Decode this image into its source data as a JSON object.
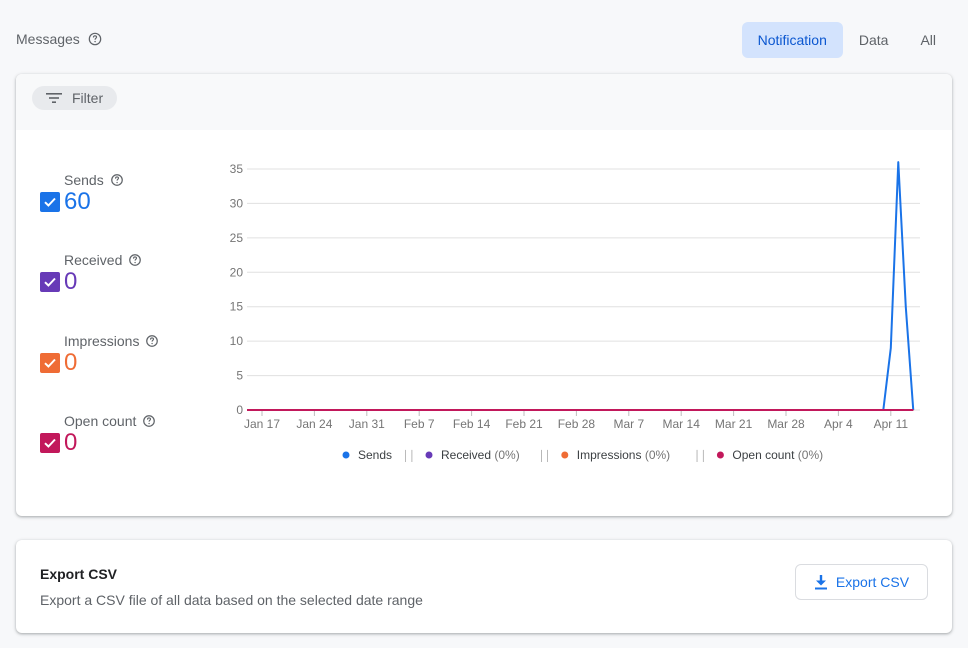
{
  "header": {
    "title": "Messages",
    "segments": [
      "Notification",
      "Data",
      "All"
    ],
    "active_segment": "Notification"
  },
  "filter": {
    "label": "Filter"
  },
  "metrics": [
    {
      "label": "Sends",
      "value": "60",
      "color": "#1a73e8"
    },
    {
      "label": "Received",
      "value": "0",
      "color": "#673ab7"
    },
    {
      "label": "Impressions",
      "value": "0",
      "color": "#ef6c35"
    },
    {
      "label": "Open count",
      "value": "0",
      "color": "#c2185b"
    }
  ],
  "chart_data": {
    "type": "line",
    "x_tick_labels": [
      "Jan 17",
      "Jan 24",
      "Jan 31",
      "Feb 7",
      "Feb 14",
      "Feb 21",
      "Feb 28",
      "Mar 7",
      "Mar 14",
      "Mar 21",
      "Mar 28",
      "Apr 4",
      "Apr 11"
    ],
    "y_ticks": [
      0,
      5,
      10,
      15,
      20,
      25,
      30,
      35
    ],
    "ylim": [
      0,
      35
    ],
    "grid": true,
    "legend_position": "bottom",
    "legend": [
      {
        "name": "Sends",
        "suffix": "",
        "color": "#1a73e8"
      },
      {
        "name": "Received",
        "suffix": "(0%)",
        "color": "#673ab7"
      },
      {
        "name": "Impressions",
        "suffix": "(0%)",
        "color": "#ef6c35"
      },
      {
        "name": "Open count",
        "suffix": "(0%)",
        "color": "#c2185b"
      }
    ],
    "series": [
      {
        "name": "Sends",
        "color": "#1a73e8",
        "x": [
          "Jan 15",
          "Apr 10",
          "Apr 11",
          "Apr 12",
          "Apr 13",
          "Apr 14"
        ],
        "values": [
          0,
          0,
          9,
          36,
          15,
          0
        ]
      },
      {
        "name": "Received",
        "color": "#673ab7",
        "x": [
          "Jan 15",
          "Apr 14"
        ],
        "values": [
          0,
          0
        ]
      },
      {
        "name": "Impressions",
        "color": "#ef6c35",
        "x": [
          "Jan 15",
          "Apr 14"
        ],
        "values": [
          0,
          0
        ]
      },
      {
        "name": "Open count",
        "color": "#c2185b",
        "x": [
          "Jan 15",
          "Apr 14"
        ],
        "values": [
          0,
          0
        ]
      }
    ]
  },
  "export": {
    "title": "Export CSV",
    "description": "Export a CSV file of all data based on the selected date range",
    "button_label": "Export CSV"
  }
}
